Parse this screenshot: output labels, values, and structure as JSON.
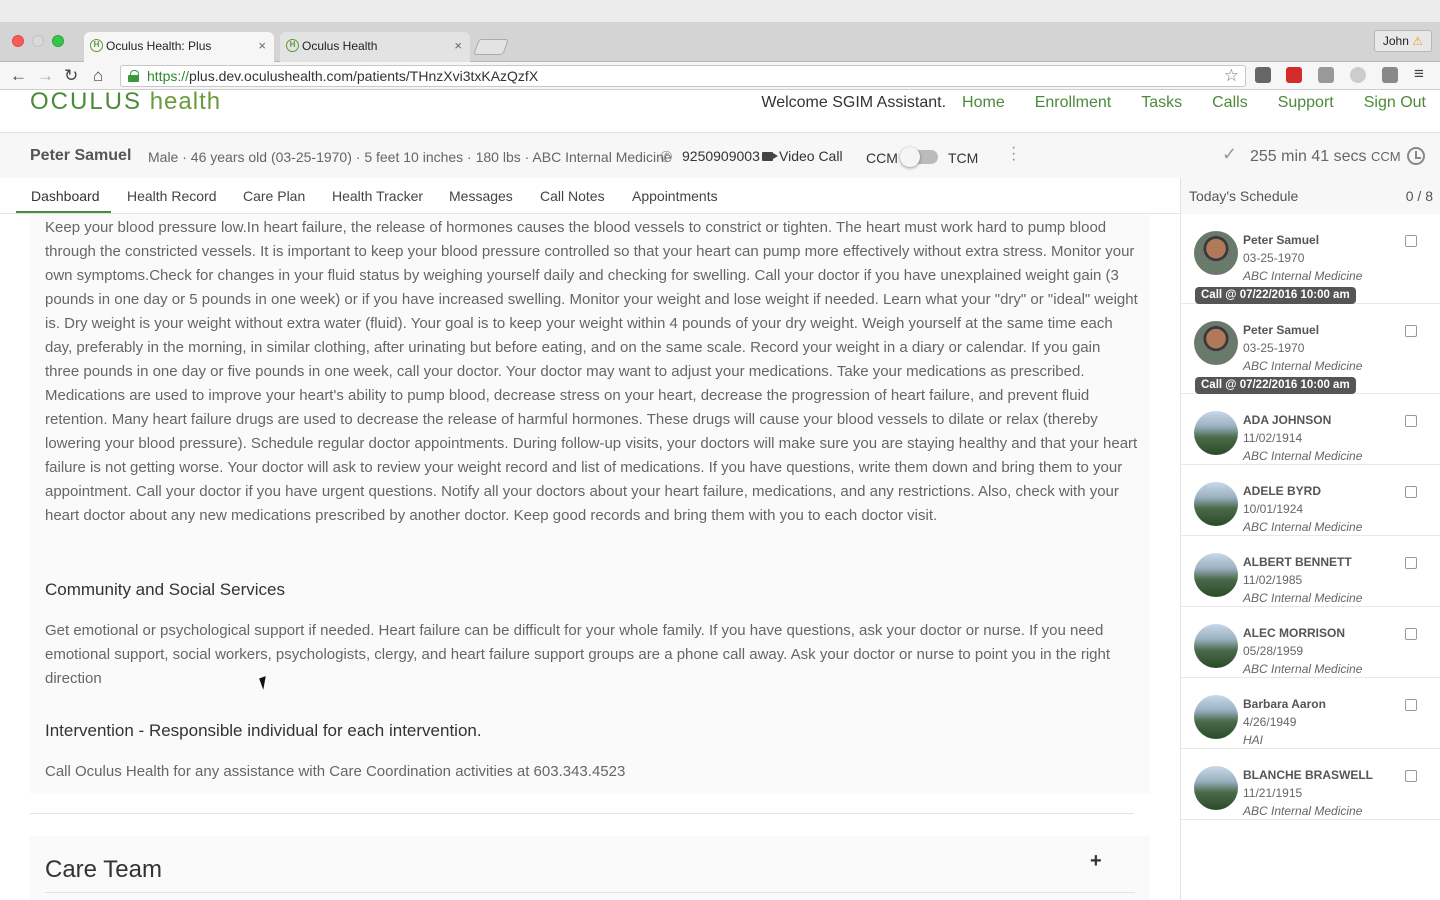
{
  "browser": {
    "tabs": [
      {
        "label": "Oculus Health: Plus",
        "active": true
      },
      {
        "label": "Oculus Health",
        "active": false
      }
    ],
    "user": "John",
    "url_https": "https://",
    "url_rest": "plus.dev.oculushealth.com/patients/THnzXvi3txKAzQzfX"
  },
  "header": {
    "logo_main": "OCULUS",
    "logo_sub": "health",
    "welcome": "Welcome SGIM Assistant.",
    "nav": [
      "Home",
      "Enrollment",
      "Tasks",
      "Calls",
      "Support",
      "Sign Out"
    ]
  },
  "patient": {
    "name": "Peter Samuel",
    "details": "Male · 46 years old (03-25-1970) · 5 feet 10 inches · 180 lbs · ABC Internal Medicine",
    "phone": "9250909003",
    "video_call": "Video Call",
    "ccm": "CCM",
    "tcm": "TCM",
    "timer": "255 min 41 secs",
    "timer_unit": "CCM"
  },
  "tabs": [
    "Dashboard",
    "Health Record",
    "Care Plan",
    "Health Tracker",
    "Messages",
    "Call Notes",
    "Appointments"
  ],
  "content": {
    "paragraph1": "Keep your blood pressure low.In heart failure, the release of hormones causes the blood vessels to constrict or tighten. The heart must work hard to pump blood through the constricted vessels. It is important to keep your blood pressure controlled so that your heart can pump more effectively without extra stress. Monitor your own symptoms.Check for changes in your fluid status by weighing yourself daily and checking for swelling. Call your doctor if you have unexplained weight gain (3 pounds in one day or 5 pounds in one week) or if you have increased swelling. Monitor your weight and lose weight if needed. Learn what your \"dry\" or \"ideal\" weight is. Dry weight is your weight without extra water (fluid). Your goal is to keep your weight within 4 pounds of your dry weight. Weigh yourself at the same time each day, preferably in the morning, in similar clothing, after urinating but before eating, and on the same scale. Record your weight in a diary or calendar. If you gain three pounds in one day or five pounds in one week, call your doctor. Your doctor may want to adjust your medications. Take your medications as prescribed. Medications are used to improve your heart's ability to pump blood, decrease stress on your heart, decrease the progression of heart failure, and prevent fluid retention. Many heart failure drugs are used to decrease the release of harmful hormones. These drugs will cause your blood vessels to dilate or relax (thereby lowering your blood pressure). Schedule regular doctor appointments. During follow-up visits, your doctors will make sure you are staying healthy and that your heart failure is not getting worse. Your doctor will ask to review your weight record and list of medications. If you have questions, write them down and bring them to your appointment. Call your doctor if you have urgent questions. Notify all your doctors about your heart failure, medications, and any restrictions. Also, check with your heart doctor about any new medications prescribed by another doctor. Keep good records and bring them with you to each doctor visit.",
    "heading2": "Community and Social Services",
    "paragraph2": "Get emotional or psychological support if needed. Heart failure can be difficult for your whole family. If you have questions, ask your doctor or nurse. If you need emotional support, social workers, psychologists, clergy, and heart failure support groups are a phone call away. Ask your doctor or nurse to point you in the right direction",
    "heading3": "Intervention - Responsible individual for each intervention.",
    "paragraph3": "Call Oculus Health for any assistance with Care Coordination activities at 603.343.4523",
    "care_team_title": "Care Team",
    "care_team_add": "+"
  },
  "schedule": {
    "title": "Today's Schedule",
    "count": "0 / 8",
    "items": [
      {
        "name": "Peter Samuel",
        "dob": "03-25-1970",
        "org": "ABC Internal Medicine",
        "badge": "Call @ 07/22/2016 10:00 am",
        "avatar": "person"
      },
      {
        "name": "Peter Samuel",
        "dob": "03-25-1970",
        "org": "ABC Internal Medicine",
        "badge": "Call @ 07/22/2016 10:00 am",
        "avatar": "person"
      },
      {
        "name": "ADA JOHNSON",
        "dob": "11/02/1914",
        "org": "ABC Internal Medicine",
        "avatar": "landscape"
      },
      {
        "name": "ADELE BYRD",
        "dob": "10/01/1924",
        "org": "ABC Internal Medicine",
        "avatar": "landscape"
      },
      {
        "name": "ALBERT BENNETT",
        "dob": "11/02/1985",
        "org": "ABC Internal Medicine",
        "avatar": "landscape"
      },
      {
        "name": "ALEC MORRISON",
        "dob": "05/28/1959",
        "org": "ABC Internal Medicine",
        "avatar": "landscape"
      },
      {
        "name": "Barbara Aaron",
        "dob": "4/26/1949",
        "org": "HAI",
        "avatar": "landscape"
      },
      {
        "name": "BLANCHE BRASWELL",
        "dob": "11/21/1915",
        "org": "ABC Internal Medicine",
        "avatar": "landscape"
      }
    ]
  },
  "colors": {
    "brand_green": "#4c8a3a",
    "badge_bg": "#555555"
  }
}
